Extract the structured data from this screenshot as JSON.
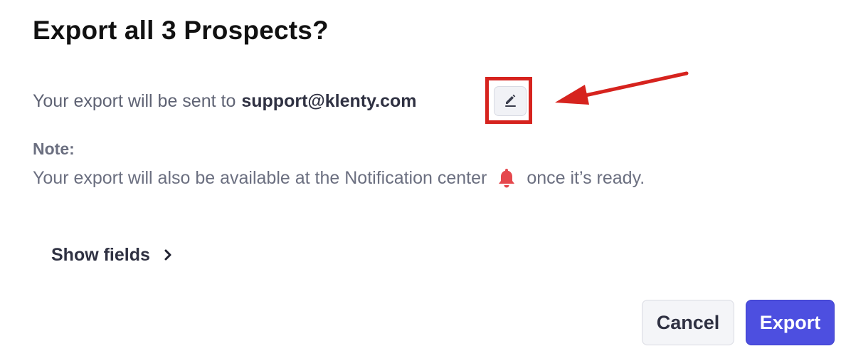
{
  "dialog": {
    "title": "Export all 3 Prospects?",
    "sent_prefix": "Your export will be sent to",
    "email": "support@klenty.com",
    "edit_icon": "pencil-icon",
    "note_label": "Note:",
    "note_text_before": "Your export will also be available at the Notification center",
    "note_icon": "bell-icon",
    "note_text_after": "once it’s ready.",
    "show_fields_label": "Show fields",
    "show_fields_icon": "chevron-right-icon",
    "cancel_label": "Cancel",
    "export_label": "Export"
  },
  "annotation": {
    "highlight_color": "#d6231e"
  },
  "colors": {
    "primary": "#4d4fe0",
    "bell": "#e5484d",
    "muted_text": "#6b6f80",
    "strong_text": "#2f3142"
  }
}
